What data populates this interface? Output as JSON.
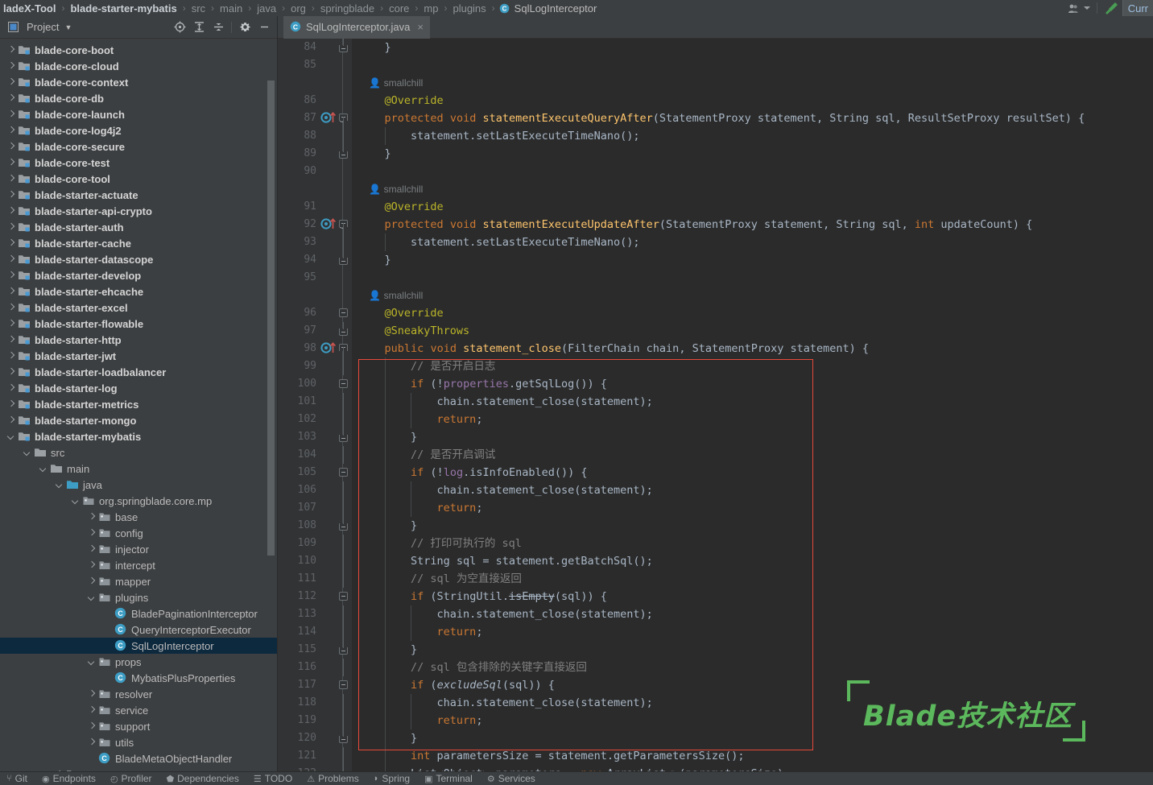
{
  "window": {
    "breadcrumb": [
      {
        "label": "ladeX-Tool",
        "style": "bold"
      },
      {
        "label": "blade-starter-mybatis",
        "style": "bold"
      },
      {
        "label": "src",
        "style": "dim"
      },
      {
        "label": "main",
        "style": "dim"
      },
      {
        "label": "java",
        "style": "dim"
      },
      {
        "label": "org",
        "style": "dim"
      },
      {
        "label": "springblade",
        "style": "dim"
      },
      {
        "label": "core",
        "style": "dim"
      },
      {
        "label": "mp",
        "style": "dim"
      },
      {
        "label": "plugins",
        "style": "dim"
      },
      {
        "label": "SqlLogInterceptor",
        "style": "file",
        "icon": "java-class-icon"
      }
    ],
    "separator": "›",
    "right_controls": {
      "account_icon": "user-account-icon",
      "account_caret": "chevron-down-icon",
      "build_icon": "build-hammer-icon",
      "run_config_label": "Curr"
    }
  },
  "toolwindow": {
    "title": "Project",
    "title_icon": "project-view-icon",
    "caret": "chevron-down-icon",
    "actions": [
      {
        "name": "select-opened-file-icon",
        "label": "Select Opened File"
      },
      {
        "name": "expand-all-icon",
        "label": "Expand All"
      },
      {
        "name": "collapse-all-icon",
        "label": "Collapse All"
      },
      {
        "name": "settings-gear-icon",
        "label": "Options"
      },
      {
        "name": "hide-icon",
        "label": "Hide"
      }
    ]
  },
  "project_tree": [
    {
      "label": "blade-core-boot",
      "indent": 0,
      "arrow": "right",
      "icon": "module-icon",
      "bold": true
    },
    {
      "label": "blade-core-cloud",
      "indent": 0,
      "arrow": "right",
      "icon": "module-icon",
      "bold": true
    },
    {
      "label": "blade-core-context",
      "indent": 0,
      "arrow": "right",
      "icon": "module-icon",
      "bold": true
    },
    {
      "label": "blade-core-db",
      "indent": 0,
      "arrow": "right",
      "icon": "module-icon",
      "bold": true
    },
    {
      "label": "blade-core-launch",
      "indent": 0,
      "arrow": "right",
      "icon": "module-icon",
      "bold": true
    },
    {
      "label": "blade-core-log4j2",
      "indent": 0,
      "arrow": "right",
      "icon": "module-icon",
      "bold": true
    },
    {
      "label": "blade-core-secure",
      "indent": 0,
      "arrow": "right",
      "icon": "module-icon",
      "bold": true
    },
    {
      "label": "blade-core-test",
      "indent": 0,
      "arrow": "right",
      "icon": "module-icon",
      "bold": true
    },
    {
      "label": "blade-core-tool",
      "indent": 0,
      "arrow": "right",
      "icon": "module-icon",
      "bold": true
    },
    {
      "label": "blade-starter-actuate",
      "indent": 0,
      "arrow": "right",
      "icon": "module-icon",
      "bold": true
    },
    {
      "label": "blade-starter-api-crypto",
      "indent": 0,
      "arrow": "right",
      "icon": "module-icon",
      "bold": true
    },
    {
      "label": "blade-starter-auth",
      "indent": 0,
      "arrow": "right",
      "icon": "module-icon",
      "bold": true
    },
    {
      "label": "blade-starter-cache",
      "indent": 0,
      "arrow": "right",
      "icon": "module-icon",
      "bold": true
    },
    {
      "label": "blade-starter-datascope",
      "indent": 0,
      "arrow": "right",
      "icon": "module-icon",
      "bold": true
    },
    {
      "label": "blade-starter-develop",
      "indent": 0,
      "arrow": "right",
      "icon": "module-icon",
      "bold": true
    },
    {
      "label": "blade-starter-ehcache",
      "indent": 0,
      "arrow": "right",
      "icon": "module-icon",
      "bold": true
    },
    {
      "label": "blade-starter-excel",
      "indent": 0,
      "arrow": "right",
      "icon": "module-icon",
      "bold": true
    },
    {
      "label": "blade-starter-flowable",
      "indent": 0,
      "arrow": "right",
      "icon": "module-icon",
      "bold": true
    },
    {
      "label": "blade-starter-http",
      "indent": 0,
      "arrow": "right",
      "icon": "module-icon",
      "bold": true
    },
    {
      "label": "blade-starter-jwt",
      "indent": 0,
      "arrow": "right",
      "icon": "module-icon",
      "bold": true
    },
    {
      "label": "blade-starter-loadbalancer",
      "indent": 0,
      "arrow": "right",
      "icon": "module-icon",
      "bold": true
    },
    {
      "label": "blade-starter-log",
      "indent": 0,
      "arrow": "right",
      "icon": "module-icon",
      "bold": true
    },
    {
      "label": "blade-starter-metrics",
      "indent": 0,
      "arrow": "right",
      "icon": "module-icon",
      "bold": true
    },
    {
      "label": "blade-starter-mongo",
      "indent": 0,
      "arrow": "right",
      "icon": "module-icon",
      "bold": true
    },
    {
      "label": "blade-starter-mybatis",
      "indent": 0,
      "arrow": "down",
      "icon": "module-icon",
      "bold": true
    },
    {
      "label": "src",
      "indent": 1,
      "arrow": "down",
      "icon": "folder-icon"
    },
    {
      "label": "main",
      "indent": 2,
      "arrow": "down",
      "icon": "folder-icon"
    },
    {
      "label": "java",
      "indent": 3,
      "arrow": "down",
      "icon": "source-root-icon"
    },
    {
      "label": "org.springblade.core.mp",
      "indent": 4,
      "arrow": "down",
      "icon": "package-icon"
    },
    {
      "label": "base",
      "indent": 5,
      "arrow": "right",
      "icon": "package-icon"
    },
    {
      "label": "config",
      "indent": 5,
      "arrow": "right",
      "icon": "package-icon"
    },
    {
      "label": "injector",
      "indent": 5,
      "arrow": "right",
      "icon": "package-icon"
    },
    {
      "label": "intercept",
      "indent": 5,
      "arrow": "right",
      "icon": "package-icon"
    },
    {
      "label": "mapper",
      "indent": 5,
      "arrow": "right",
      "icon": "package-icon"
    },
    {
      "label": "plugins",
      "indent": 5,
      "arrow": "down",
      "icon": "package-icon"
    },
    {
      "label": "BladePaginationInterceptor",
      "indent": 6,
      "arrow": "none",
      "icon": "java-class-icon"
    },
    {
      "label": "QueryInterceptorExecutor",
      "indent": 6,
      "arrow": "none",
      "icon": "java-class-icon"
    },
    {
      "label": "SqlLogInterceptor",
      "indent": 6,
      "arrow": "none",
      "icon": "java-class-icon",
      "selected": true
    },
    {
      "label": "props",
      "indent": 5,
      "arrow": "down",
      "icon": "package-icon"
    },
    {
      "label": "MybatisPlusProperties",
      "indent": 6,
      "arrow": "none",
      "icon": "java-class-icon"
    },
    {
      "label": "resolver",
      "indent": 5,
      "arrow": "right",
      "icon": "package-icon"
    },
    {
      "label": "service",
      "indent": 5,
      "arrow": "right",
      "icon": "package-icon"
    },
    {
      "label": "support",
      "indent": 5,
      "arrow": "right",
      "icon": "package-icon"
    },
    {
      "label": "utils",
      "indent": 5,
      "arrow": "right",
      "icon": "package-icon"
    },
    {
      "label": "BladeMetaObjectHandler",
      "indent": 5,
      "arrow": "none",
      "icon": "java-class-icon"
    },
    {
      "label": "resources",
      "indent": 3,
      "arrow": "right",
      "icon": "resources-root-icon"
    }
  ],
  "editor": {
    "tab": {
      "label": "SqlLogInterceptor.java",
      "icon": "java-class-icon",
      "close": "×"
    },
    "annotation_box": {
      "color": "#e8493a",
      "from_line": 99,
      "to_line": 121
    },
    "watermark": {
      "text": "Blade技术社区",
      "color": "#5cb85c"
    },
    "lines": [
      {
        "n": "84",
        "fold": "bot",
        "indent": 1,
        "tokens": [
          {
            "t": "    }",
            "c": "pln"
          }
        ]
      },
      {
        "n": "85",
        "tokens": []
      },
      {
        "n": "",
        "tokens": [
          {
            "t": "    👤 smallchill",
            "c": "smch"
          }
        ],
        "inlay": true
      },
      {
        "n": "86",
        "tokens": [
          {
            "t": "    @Override",
            "c": "ann"
          }
        ]
      },
      {
        "n": "87",
        "gutter": "override",
        "fold": "top",
        "tokens": [
          {
            "t": "    ",
            "c": "pln"
          },
          {
            "t": "protected",
            "c": "kw"
          },
          {
            "t": " ",
            "c": "pln"
          },
          {
            "t": "void",
            "c": "kw"
          },
          {
            "t": " ",
            "c": "pln"
          },
          {
            "t": "statementExecuteQueryAfter",
            "c": "mth"
          },
          {
            "t": "(StatementProxy statement, String sql, ResultSetProxy resultSet) {",
            "c": "pln"
          }
        ]
      },
      {
        "n": "88",
        "guide": 1,
        "tokens": [
          {
            "t": "        statement.setLastExecuteTimeNano();",
            "c": "pln"
          }
        ]
      },
      {
        "n": "89",
        "fold": "bot",
        "tokens": [
          {
            "t": "    }",
            "c": "pln"
          }
        ]
      },
      {
        "n": "90",
        "tokens": []
      },
      {
        "n": "",
        "tokens": [
          {
            "t": "    👤 smallchill",
            "c": "smch"
          }
        ],
        "inlay": true
      },
      {
        "n": "91",
        "tokens": [
          {
            "t": "    @Override",
            "c": "ann"
          }
        ]
      },
      {
        "n": "92",
        "gutter": "override",
        "fold": "top",
        "tokens": [
          {
            "t": "    ",
            "c": "pln"
          },
          {
            "t": "protected",
            "c": "kw"
          },
          {
            "t": " ",
            "c": "pln"
          },
          {
            "t": "void",
            "c": "kw"
          },
          {
            "t": " ",
            "c": "pln"
          },
          {
            "t": "statementExecuteUpdateAfter",
            "c": "mth"
          },
          {
            "t": "(StatementProxy statement, String sql, ",
            "c": "pln"
          },
          {
            "t": "int",
            "c": "kw"
          },
          {
            "t": " updateCount) {",
            "c": "pln"
          }
        ]
      },
      {
        "n": "93",
        "guide": 1,
        "tokens": [
          {
            "t": "        statement.setLastExecuteTimeNano();",
            "c": "pln"
          }
        ]
      },
      {
        "n": "94",
        "fold": "bot",
        "tokens": [
          {
            "t": "    }",
            "c": "pln"
          }
        ]
      },
      {
        "n": "95",
        "tokens": []
      },
      {
        "n": "",
        "tokens": [
          {
            "t": "    👤 smallchill",
            "c": "smch"
          }
        ],
        "inlay": true
      },
      {
        "n": "96",
        "fold": "minus",
        "tokens": [
          {
            "t": "    @Override",
            "c": "ann"
          }
        ]
      },
      {
        "n": "97",
        "fold": "bot2",
        "tokens": [
          {
            "t": "    @SneakyThrows",
            "c": "ann"
          }
        ]
      },
      {
        "n": "98",
        "gutter": "override2",
        "fold": "top",
        "tokens": [
          {
            "t": "    ",
            "c": "pln"
          },
          {
            "t": "public",
            "c": "kw"
          },
          {
            "t": " ",
            "c": "pln"
          },
          {
            "t": "void",
            "c": "kw"
          },
          {
            "t": " ",
            "c": "pln"
          },
          {
            "t": "statement_close",
            "c": "mth"
          },
          {
            "t": "(FilterChain chain, StatementProxy statement) {",
            "c": "pln"
          }
        ]
      },
      {
        "n": "99",
        "guide": 1,
        "tokens": [
          {
            "t": "        // 是否开启日志",
            "c": "cm"
          }
        ]
      },
      {
        "n": "100",
        "guide": 1,
        "fold": "minus",
        "tokens": [
          {
            "t": "        ",
            "c": "pln"
          },
          {
            "t": "if",
            "c": "kw"
          },
          {
            "t": " (!",
            "c": "pln"
          },
          {
            "t": "properties",
            "c": "fld"
          },
          {
            "t": ".getSqlLog()) {",
            "c": "pln"
          }
        ]
      },
      {
        "n": "101",
        "guide": 2,
        "tokens": [
          {
            "t": "            chain.statement_close(statement);",
            "c": "pln"
          }
        ]
      },
      {
        "n": "102",
        "guide": 2,
        "tokens": [
          {
            "t": "            ",
            "c": "pln"
          },
          {
            "t": "return",
            "c": "kw"
          },
          {
            "t": ";",
            "c": "pln"
          }
        ]
      },
      {
        "n": "103",
        "guide": 1,
        "fold": "bot",
        "tokens": [
          {
            "t": "        }",
            "c": "pln"
          }
        ]
      },
      {
        "n": "104",
        "guide": 1,
        "tokens": [
          {
            "t": "        // 是否开启调试",
            "c": "cm"
          }
        ]
      },
      {
        "n": "105",
        "guide": 1,
        "fold": "minus",
        "tokens": [
          {
            "t": "        ",
            "c": "pln"
          },
          {
            "t": "if",
            "c": "kw"
          },
          {
            "t": " (!",
            "c": "pln"
          },
          {
            "t": "log",
            "c": "fld"
          },
          {
            "t": ".isInfoEnabled()) {",
            "c": "pln"
          }
        ]
      },
      {
        "n": "106",
        "guide": 2,
        "tokens": [
          {
            "t": "            chain.statement_close(statement);",
            "c": "pln"
          }
        ]
      },
      {
        "n": "107",
        "guide": 2,
        "tokens": [
          {
            "t": "            ",
            "c": "pln"
          },
          {
            "t": "return",
            "c": "kw"
          },
          {
            "t": ";",
            "c": "pln"
          }
        ]
      },
      {
        "n": "108",
        "guide": 1,
        "fold": "bot",
        "tokens": [
          {
            "t": "        }",
            "c": "pln"
          }
        ]
      },
      {
        "n": "109",
        "guide": 1,
        "tokens": [
          {
            "t": "        // 打印可执行的 sql",
            "c": "cm"
          }
        ]
      },
      {
        "n": "110",
        "guide": 1,
        "tokens": [
          {
            "t": "        String sql = statement.getBatchSql();",
            "c": "pln"
          }
        ]
      },
      {
        "n": "111",
        "guide": 1,
        "tokens": [
          {
            "t": "        // sql 为空直接返回",
            "c": "cm"
          }
        ]
      },
      {
        "n": "112",
        "guide": 1,
        "fold": "minus",
        "tokens": [
          {
            "t": "        ",
            "c": "pln"
          },
          {
            "t": "if",
            "c": "kw"
          },
          {
            "t": " (StringUtil.",
            "c": "pln"
          },
          {
            "t": "isEmpty",
            "c": "dep"
          },
          {
            "t": "(sql)) {",
            "c": "pln"
          }
        ]
      },
      {
        "n": "113",
        "guide": 2,
        "tokens": [
          {
            "t": "            chain.statement_close(statement);",
            "c": "pln"
          }
        ]
      },
      {
        "n": "114",
        "guide": 2,
        "tokens": [
          {
            "t": "            ",
            "c": "pln"
          },
          {
            "t": "return",
            "c": "kw"
          },
          {
            "t": ";",
            "c": "pln"
          }
        ]
      },
      {
        "n": "115",
        "guide": 1,
        "fold": "bot",
        "tokens": [
          {
            "t": "        }",
            "c": "pln"
          }
        ]
      },
      {
        "n": "116",
        "guide": 1,
        "tokens": [
          {
            "t": "        // sql 包含排除的关键字直接返回",
            "c": "cm"
          }
        ]
      },
      {
        "n": "117",
        "guide": 1,
        "fold": "minus",
        "tokens": [
          {
            "t": "        ",
            "c": "pln"
          },
          {
            "t": "if",
            "c": "kw"
          },
          {
            "t": " (",
            "c": "pln"
          },
          {
            "t": "excludeSql",
            "c": "stat"
          },
          {
            "t": "(sql)) {",
            "c": "pln"
          }
        ]
      },
      {
        "n": "118",
        "guide": 2,
        "tokens": [
          {
            "t": "            chain.statement_close(statement);",
            "c": "pln"
          }
        ]
      },
      {
        "n": "119",
        "guide": 2,
        "tokens": [
          {
            "t": "            ",
            "c": "pln"
          },
          {
            "t": "return",
            "c": "kw"
          },
          {
            "t": ";",
            "c": "pln"
          }
        ]
      },
      {
        "n": "120",
        "guide": 1,
        "fold": "bot",
        "tokens": [
          {
            "t": "        }",
            "c": "pln"
          }
        ]
      },
      {
        "n": "121",
        "guide": 1,
        "tokens": [
          {
            "t": "        ",
            "c": "pln"
          },
          {
            "t": "int",
            "c": "kw"
          },
          {
            "t": " parametersSize = statement.getParametersSize();",
            "c": "pln"
          }
        ]
      },
      {
        "n": "122",
        "guide": 1,
        "tokens": [
          {
            "t": "        List<Object> parameters = ",
            "c": "pln"
          },
          {
            "t": "new",
            "c": "kw"
          },
          {
            "t": " ArrayList<>(parametersSize);",
            "c": "pln"
          }
        ]
      }
    ]
  },
  "statusbar": [
    {
      "label": "Git",
      "icon": "git-branch-icon"
    },
    {
      "label": "Endpoints",
      "icon": "endpoints-icon"
    },
    {
      "label": "Profiler",
      "icon": "profiler-icon"
    },
    {
      "label": "Dependencies",
      "icon": "dependencies-icon"
    },
    {
      "label": "TODO",
      "icon": "todo-icon"
    },
    {
      "label": "Problems",
      "icon": "problems-icon"
    },
    {
      "label": "Spring",
      "icon": "spring-icon"
    },
    {
      "label": "Terminal",
      "icon": "terminal-icon"
    },
    {
      "label": "Services",
      "icon": "services-icon"
    }
  ]
}
